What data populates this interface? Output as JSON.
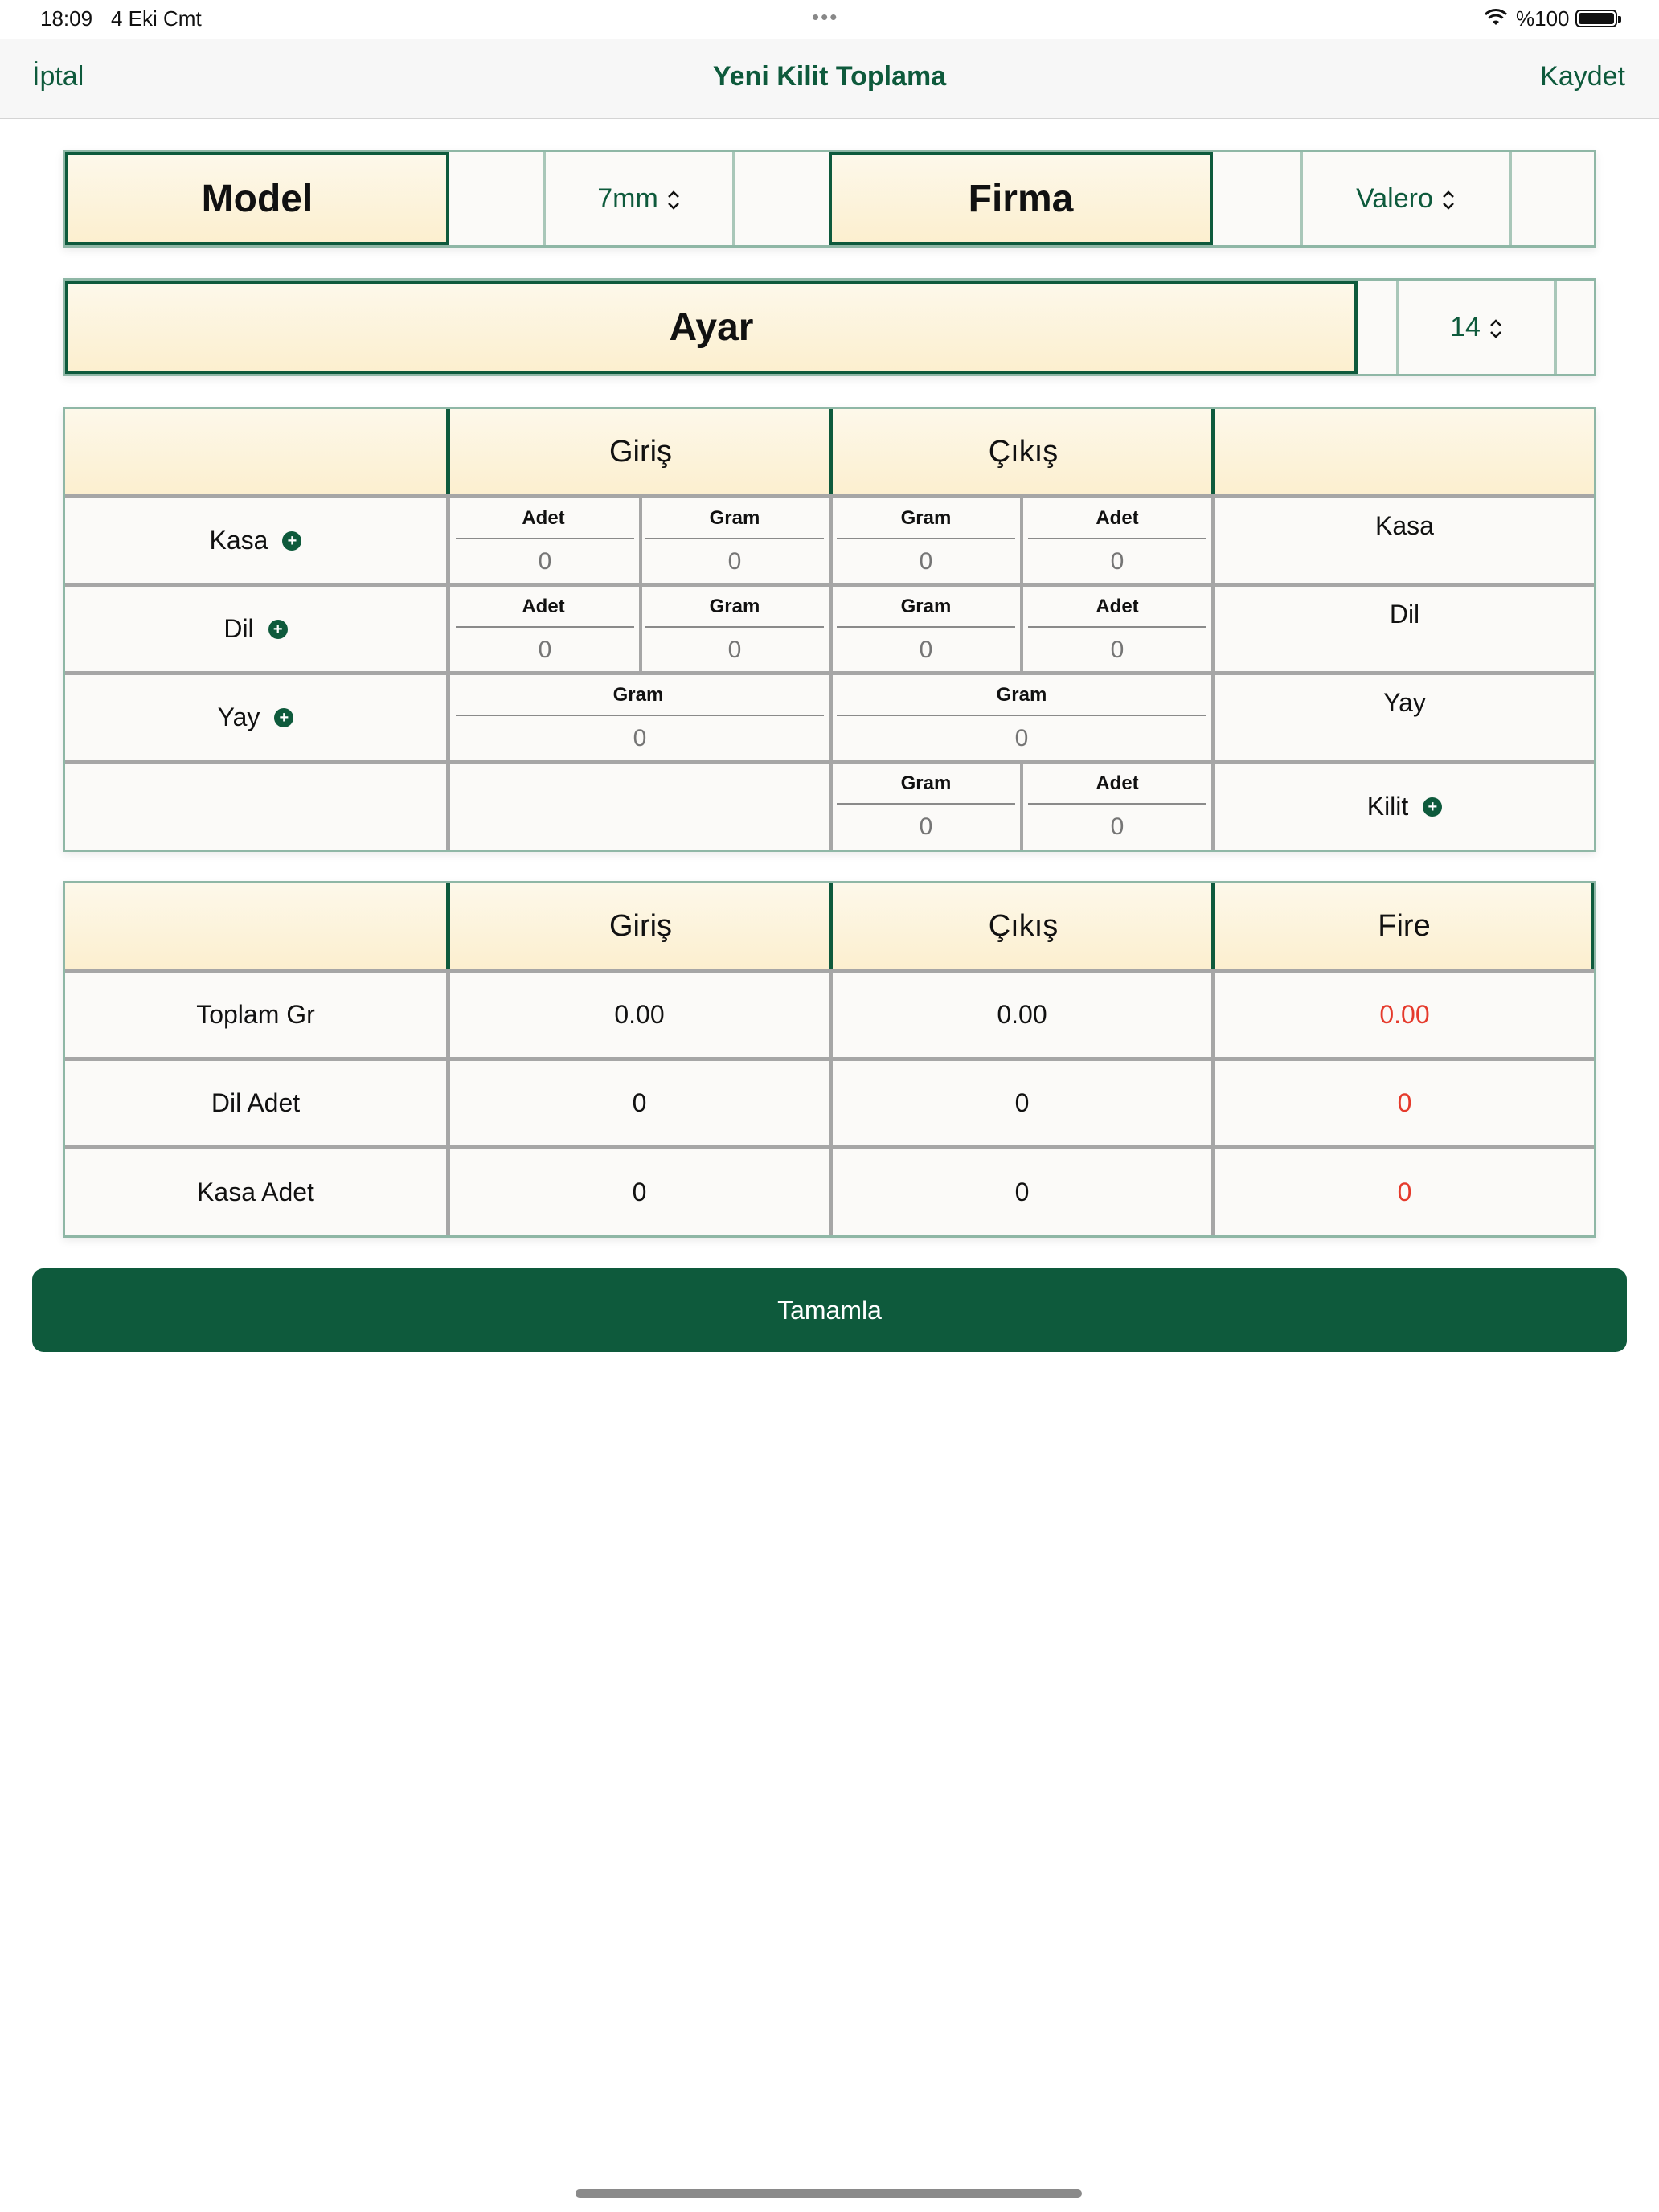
{
  "status": {
    "time": "18:09",
    "date": "4 Eki Cmt",
    "battery": "%100"
  },
  "nav": {
    "cancel": "İptal",
    "title": "Yeni Kilit Toplama",
    "save": "Kaydet"
  },
  "top": {
    "model_label": "Model",
    "model_value": "7mm",
    "firma_label": "Firma",
    "firma_value": "Valero",
    "ayar_label": "Ayar",
    "ayar_value": "14"
  },
  "entry_table": {
    "headers": [
      "",
      "Giriş",
      "Çıkış",
      ""
    ],
    "rows": [
      {
        "label": "Kasa",
        "in": [
          {
            "h": "Adet",
            "v": "0"
          },
          {
            "h": "Gram",
            "v": "0"
          }
        ],
        "out": [
          {
            "h": "Gram",
            "v": "0"
          },
          {
            "h": "Adet",
            "v": "0"
          }
        ],
        "right": "Kasa"
      },
      {
        "label": "Dil",
        "in": [
          {
            "h": "Adet",
            "v": "0"
          },
          {
            "h": "Gram",
            "v": "0"
          }
        ],
        "out": [
          {
            "h": "Gram",
            "v": "0"
          },
          {
            "h": "Adet",
            "v": "0"
          }
        ],
        "right": "Dil"
      },
      {
        "label": "Yay",
        "in": [
          {
            "h": "Gram",
            "v": "0"
          }
        ],
        "out": [
          {
            "h": "Gram",
            "v": "0"
          }
        ],
        "right": "Yay"
      },
      {
        "label": "",
        "in": [],
        "out": [
          {
            "h": "Gram",
            "v": "0"
          },
          {
            "h": "Adet",
            "v": "0"
          }
        ],
        "right": "Kilit"
      }
    ]
  },
  "summary_table": {
    "headers": [
      "",
      "Giriş",
      "Çıkış",
      "Fire"
    ],
    "rows": [
      {
        "label": "Toplam Gr",
        "in": "0.00",
        "out": "0.00",
        "fire": "0.00"
      },
      {
        "label": "Dil Adet",
        "in": "0",
        "out": "0",
        "fire": "0"
      },
      {
        "label": "Kasa Adet",
        "in": "0",
        "out": "0",
        "fire": "0"
      }
    ]
  },
  "complete_button": "Tamamla",
  "colors": {
    "accent": "#0e5a3c",
    "fire": "#e53a2c",
    "header_cream": "#fcefcf"
  }
}
